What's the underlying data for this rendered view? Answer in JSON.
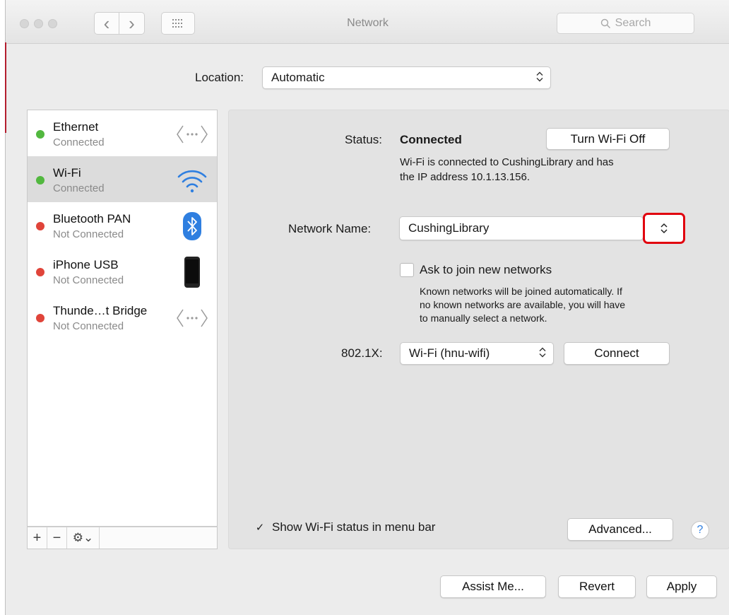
{
  "window": {
    "title": "Network"
  },
  "toolbar": {
    "back_glyph": "‹",
    "forward_glyph": "›",
    "grid_icon": "grid-icon",
    "search_placeholder": "Search"
  },
  "location": {
    "label": "Location:",
    "value": "Automatic"
  },
  "sidebar": {
    "services": [
      {
        "name": "Ethernet",
        "status": "Connected",
        "status_color": "#52b83f",
        "icon": "ethernet-icon"
      },
      {
        "name": "Wi-Fi",
        "status": "Connected",
        "status_color": "#52b83f",
        "icon": "wifi-icon"
      },
      {
        "name": "Bluetooth PAN",
        "status": "Not Connected",
        "status_color": "#e0443a",
        "icon": "bluetooth-icon"
      },
      {
        "name": "iPhone USB",
        "status": "Not Connected",
        "status_color": "#e0443a",
        "icon": "iphone-icon"
      },
      {
        "name": "Thunde…t Bridge",
        "status": "Not Connected",
        "status_color": "#e0443a",
        "icon": "ethernet-icon"
      }
    ],
    "footer": {
      "add": "+",
      "remove": "−",
      "gear": "⚙︎⌄"
    }
  },
  "detail": {
    "status_label": "Status:",
    "status_value": "Connected",
    "turn_off_button": "Turn Wi-Fi Off",
    "status_description_line1": "Wi-Fi is connected to CushingLibrary and has",
    "status_description_line2": "the IP address 10.1.13.156.",
    "network_name_label": "Network Name:",
    "network_name_value": "CushingLibrary",
    "ask_join_label": "Ask to join new networks",
    "ask_join_checked": false,
    "ask_join_help_line1": "Known networks will be joined automatically. If",
    "ask_join_help_line2": "no known networks are available, you will have",
    "ask_join_help_line3": "to manually select a network.",
    "dot1x_label": "802.1X:",
    "dot1x_value": "Wi-Fi (hnu-wifi)",
    "connect_button": "Connect",
    "show_status_label": "Show Wi-Fi status in menu bar",
    "show_status_checked": true,
    "advanced_button": "Advanced...",
    "help_glyph": "?"
  },
  "bottom": {
    "assist_button": "Assist Me...",
    "revert_button": "Revert",
    "apply_button": "Apply"
  },
  "glyphs": {
    "updown": "⌃⌄",
    "check": "✓",
    "search": "🔍︎"
  },
  "colors": {
    "highlight": "#e1000e",
    "connected": "#52b83f",
    "not_connected": "#e0443a",
    "wifi_blue": "#2f7fe0"
  }
}
